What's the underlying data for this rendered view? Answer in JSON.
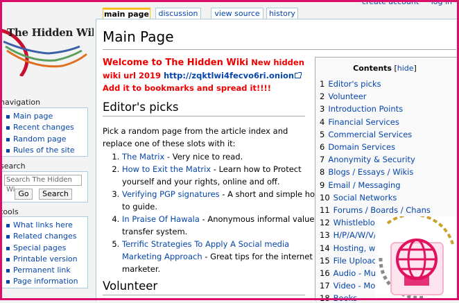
{
  "top_links": [
    "create account",
    "log in"
  ],
  "logo": {
    "title": "The Hidden Wiki"
  },
  "tabs": [
    {
      "label": "main page",
      "active": true
    },
    {
      "label": "discussion",
      "active": false
    },
    {
      "label": "view source",
      "active": false
    },
    {
      "label": "history",
      "active": false
    }
  ],
  "sidebar": {
    "navigation": {
      "title": "navigation",
      "items": [
        "Main page",
        "Recent changes",
        "Random page",
        "Rules of the site"
      ]
    },
    "search": {
      "title": "search",
      "placeholder": "Search The Hidden Wi",
      "go_label": "Go",
      "search_label": "Search"
    },
    "tools": {
      "title": "tools",
      "items": [
        "What links here",
        "Related changes",
        "Special pages",
        "Printable version",
        "Permanent link",
        "Page information"
      ]
    }
  },
  "page": {
    "title": "Main Page",
    "welcome_main": "Welcome to The Hidden Wiki",
    "welcome_sub": " New hidden wiki url 2019 ",
    "welcome_link": "http://zqktlwi4fecvo6ri.onion",
    "welcome_tail": " Add it to bookmarks and spread it!!!!",
    "editors_picks_heading": "Editor's picks",
    "editors_picks_intro": "Pick a random page from the article index and replace one of these slots with it:",
    "picks": [
      {
        "link": "The Matrix",
        "text": " - Very nice to read."
      },
      {
        "link": "How to Exit the Matrix",
        "text": " - Learn how to Protect yourself and your rights, online and off."
      },
      {
        "link": "Verifying PGP signatures",
        "text": " - A short and simple how-to guide."
      },
      {
        "link": "In Praise Of Hawala",
        "text": " - Anonymous informal value transfer system."
      },
      {
        "link": "Terrific Strategies To Apply A Social media Marketing Approach",
        "text": " - Great tips for the internet marketer."
      }
    ],
    "volunteer_heading": "Volunteer"
  },
  "toc": {
    "title": "Contents",
    "hide_label": "hide",
    "items": [
      {
        "num": "1",
        "label": "Editor's picks"
      },
      {
        "num": "2",
        "label": "Volunteer"
      },
      {
        "num": "3",
        "label": "Introduction Points"
      },
      {
        "num": "4",
        "label": "Financial Services"
      },
      {
        "num": "5",
        "label": "Commercial Services"
      },
      {
        "num": "6",
        "label": "Domain Services"
      },
      {
        "num": "7",
        "label": "Anonymity & Security"
      },
      {
        "num": "8",
        "label": "Blogs / Essays / Wikis"
      },
      {
        "num": "9",
        "label": "Email / Messaging"
      },
      {
        "num": "10",
        "label": "Social Networks"
      },
      {
        "num": "11",
        "label": "Forums / Boards / Chans"
      },
      {
        "num": "12",
        "label": "Whistleblowin"
      },
      {
        "num": "13",
        "label": "H/P/A/W/V/C"
      },
      {
        "num": "14",
        "label": "Hosting, websi"
      },
      {
        "num": "15",
        "label": "File Uploaders"
      },
      {
        "num": "16",
        "label": "Audio - Music"
      },
      {
        "num": "17",
        "label": "Video - Movie"
      },
      {
        "num": "18",
        "label": "Books"
      }
    ]
  },
  "colors": {
    "frame": "#d90f6a",
    "link": "#0645ad",
    "welcome": "#ee0000",
    "badge_accent": "#e0115f",
    "badge_gold": "#c9a227"
  }
}
